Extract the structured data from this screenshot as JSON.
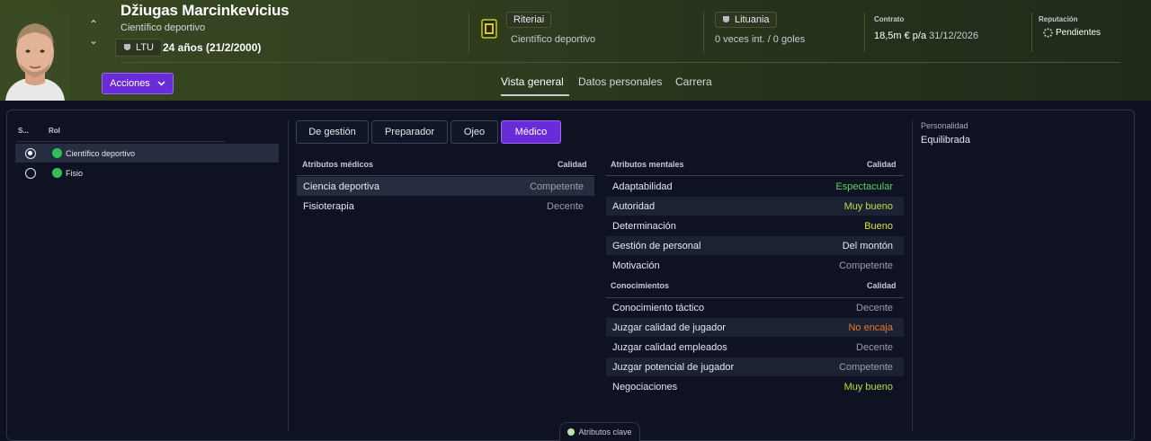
{
  "header": {
    "player_name": "Džiugas Marcinkevicius",
    "player_role": "Científico deportivo",
    "nation_code": "LTU",
    "age_text": "24 años (21/2/2000)",
    "club_name": "Riteriai",
    "club_role": "Científico deportivo",
    "country": "Lituania",
    "caps_goals": "0 veces int. / 0 goles",
    "contract_label": "Contrato",
    "contract_wage": "18,5m € p/a",
    "contract_date": "31/12/2026",
    "reputation_label": "Reputación",
    "reputation_value": "Pendientes",
    "actions_label": "Acciones",
    "tabs": [
      {
        "label": "Vista general",
        "active": true
      },
      {
        "label": "Datos personales",
        "active": false
      },
      {
        "label": "Carrera",
        "active": false
      }
    ]
  },
  "roles": {
    "col_s": "S...",
    "col_role": "Rol",
    "items": [
      {
        "label": "Científico deportivo",
        "selected": true
      },
      {
        "label": "Fisio",
        "selected": false
      }
    ]
  },
  "subtabs": [
    {
      "label": "De gestión",
      "active": false
    },
    {
      "label": "Preparador",
      "active": false
    },
    {
      "label": "Ojeo",
      "active": false
    },
    {
      "label": "Médico",
      "active": true
    }
  ],
  "medical": {
    "title": "Atributos médicos",
    "quality_label": "Calidad",
    "rows": [
      {
        "name": "Ciencia deportiva",
        "value": "Competente",
        "color": "#9aa0aa"
      },
      {
        "name": "Fisioterapia",
        "value": "Decente",
        "color": "#9aa0aa"
      }
    ]
  },
  "mental": {
    "title": "Atributos mentales",
    "quality_label": "Calidad",
    "rows": [
      {
        "name": "Adaptabilidad",
        "value": "Espectacular",
        "color": "#5fd15f"
      },
      {
        "name": "Autoridad",
        "value": "Muy bueno",
        "color": "#b6e23a"
      },
      {
        "name": "Determinación",
        "value": "Bueno",
        "color": "#d9e23a"
      },
      {
        "name": "Gestión de personal",
        "value": "Del montón",
        "color": "#e6e8ee"
      },
      {
        "name": "Motivación",
        "value": "Competente",
        "color": "#9aa0aa"
      }
    ]
  },
  "knowledge": {
    "title": "Conocimientos",
    "quality_label": "Calidad",
    "rows": [
      {
        "name": "Conocimiento táctico",
        "value": "Decente",
        "color": "#9aa0aa"
      },
      {
        "name": "Juzgar calidad de jugador",
        "value": "No encaja",
        "color": "#e8752a"
      },
      {
        "name": "Juzgar calidad empleados",
        "value": "Decente",
        "color": "#9aa0aa"
      },
      {
        "name": "Juzgar potencial de jugador",
        "value": "Competente",
        "color": "#9aa0aa"
      },
      {
        "name": "Negociaciones",
        "value": "Muy bueno",
        "color": "#b6e23a"
      }
    ]
  },
  "personality": {
    "label": "Personalidad",
    "value": "Equilibrada"
  },
  "footer": {
    "key_attributes_label": "Atributos clave"
  }
}
